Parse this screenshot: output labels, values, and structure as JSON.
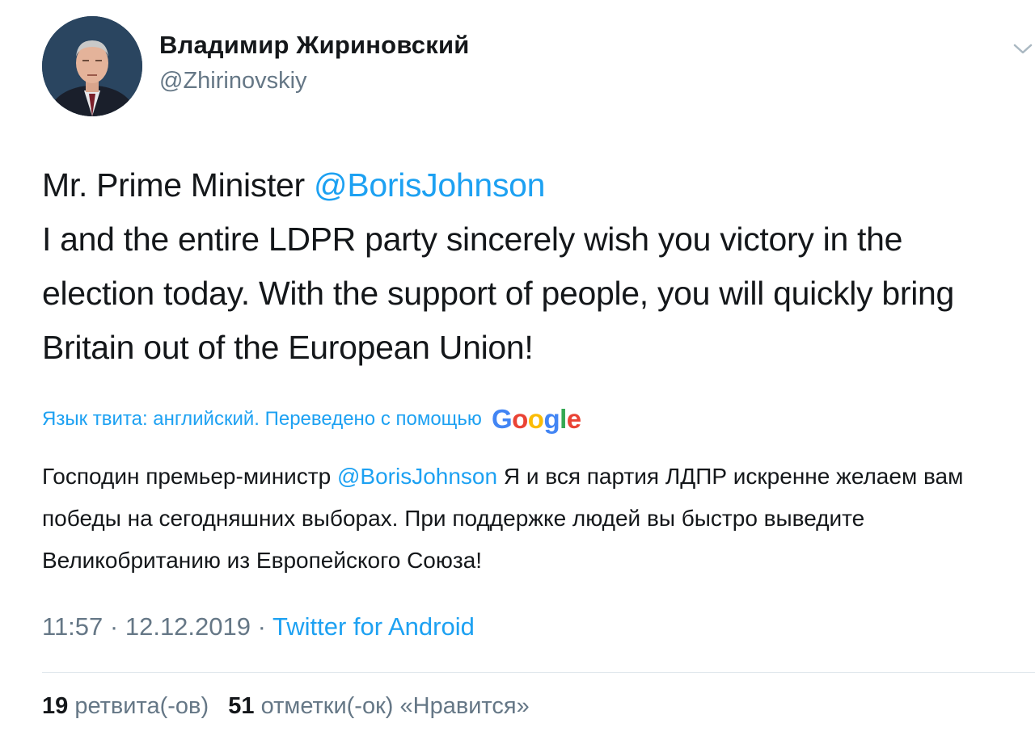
{
  "author": {
    "display_name": "Владимир Жириновский",
    "handle": "@Zhirinovskiy"
  },
  "tweet": {
    "line1_prefix": "Mr. Prime Minister ",
    "line1_mention": "@BorisJohnson",
    "body": "I and the entire LDPR party sincerely wish you victory in the election today. With the support of people, you will quickly bring Britain out of the European Union!"
  },
  "translation": {
    "notice": "Язык твита: английский. Переведено с помощью",
    "provider": "Google",
    "prefix": "Господин премьер-министр ",
    "mention": "@BorisJohnson",
    "rest": " Я и вся партия ЛДПР искренне желаем вам победы на сегодняшних выборах. При поддержке людей вы быстро выведите Великобританию из Европейского Союза!"
  },
  "meta": {
    "time": "11:57",
    "separator1": " · ",
    "date": "12.12.2019",
    "separator2": " · ",
    "source": "Twitter for Android"
  },
  "stats": {
    "retweets_count": "19",
    "retweets_label": "ретвита(-ов)",
    "likes_count": "51",
    "likes_label": "отметки(-ок) «Нравится»"
  },
  "icons": {
    "menu": "chevron-down-icon",
    "avatar": "profile-photo"
  },
  "colors": {
    "link": "#1da1f2",
    "secondary_text": "#657786",
    "primary_text": "#14171a",
    "divider": "#e1e8ed"
  }
}
